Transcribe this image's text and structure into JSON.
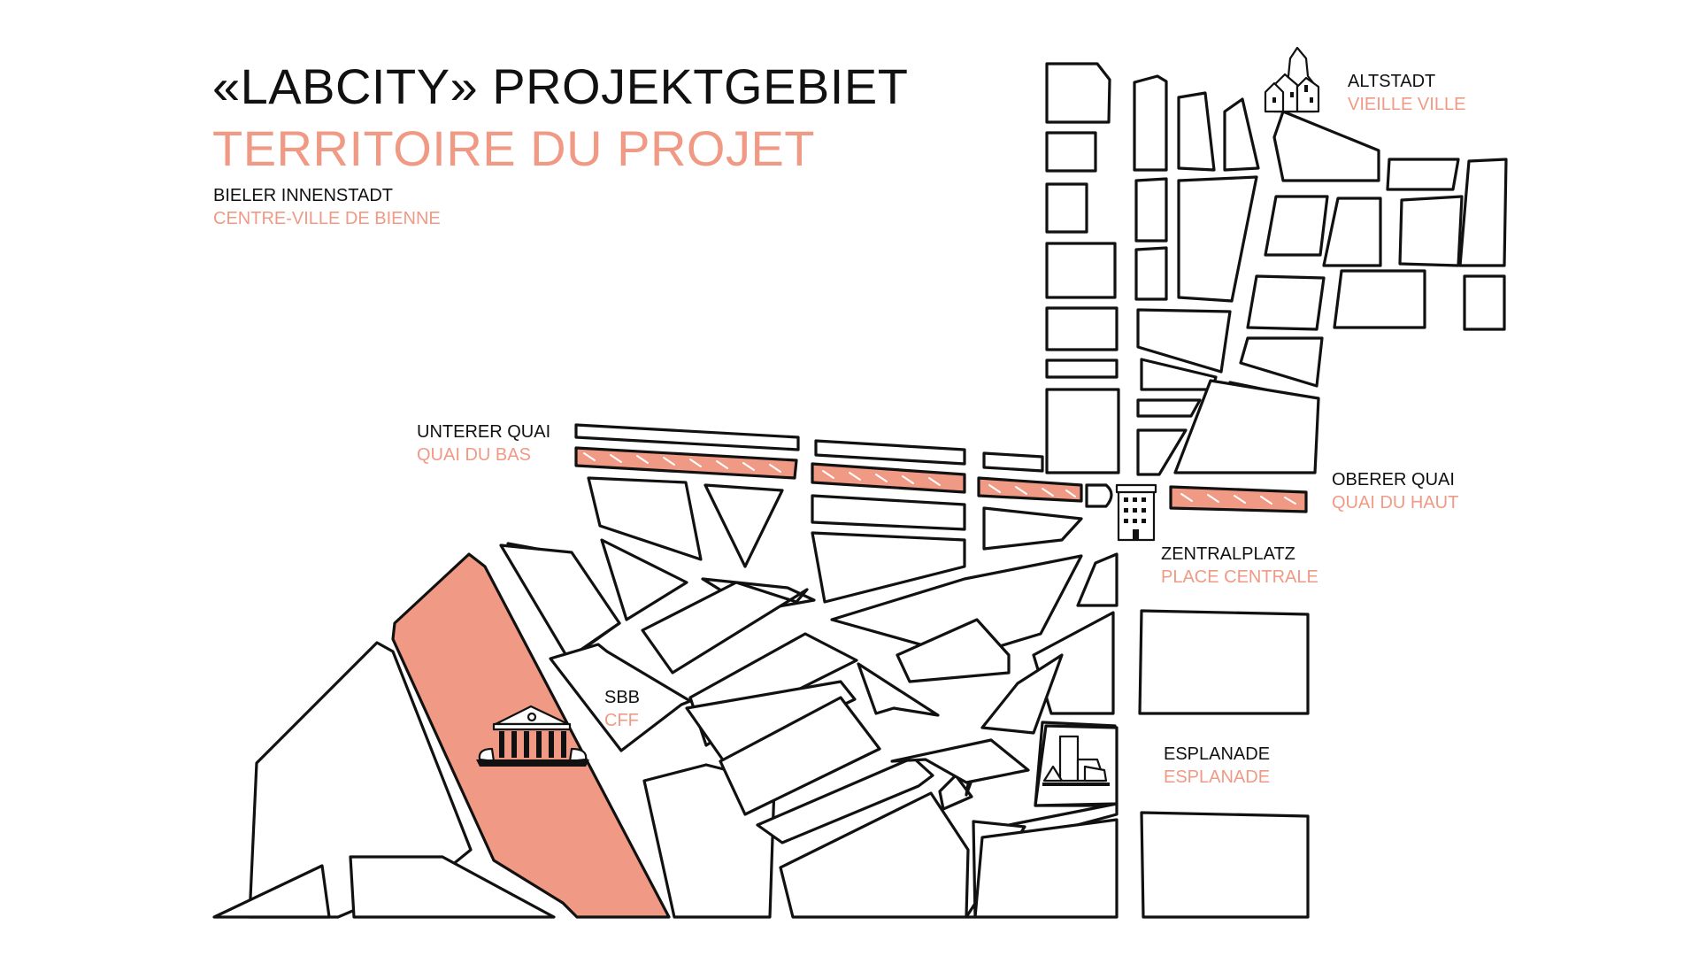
{
  "title": {
    "de": "«LABCITY» PROJEKTGEBIET",
    "fr": "TERRITOIRE DU PROJET"
  },
  "subtitle": {
    "de": "BIELER INNENSTADT",
    "fr": "CENTRE-VILLE DE BIENNE"
  },
  "places": {
    "altstadt": {
      "de": "ALTSTADT",
      "fr": "VIEILLE VILLE",
      "icon": "old-town-church-icon"
    },
    "unterer_quai": {
      "de": "UNTERER QUAI",
      "fr": "QUAI DU BAS"
    },
    "oberer_quai": {
      "de": "OBERER QUAI",
      "fr": "QUAI DU HAUT"
    },
    "zentralplatz": {
      "de": "ZENTRALPLATZ",
      "fr": "PLACE CENTRALE",
      "icon": "central-building-icon"
    },
    "sbb": {
      "de": "SBB",
      "fr": "CFF",
      "icon": "train-station-icon"
    },
    "esplanade": {
      "de": "ESPLANADE",
      "fr": "ESPLANADE",
      "icon": "esplanade-buildings-icon"
    }
  },
  "colors": {
    "accent": "#F09A85",
    "ink": "#111111",
    "background": "#ffffff"
  }
}
